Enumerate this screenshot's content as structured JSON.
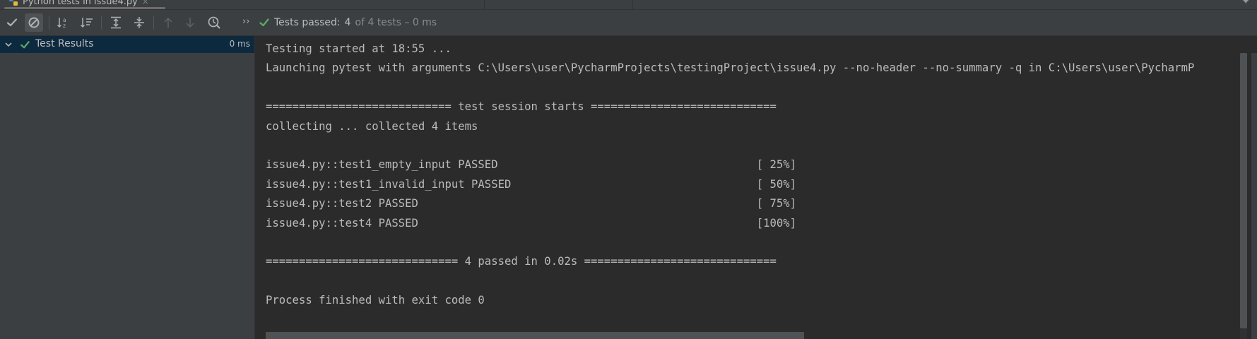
{
  "window": {
    "tab_label": "Python tests in issue4.py",
    "tab_close": "×"
  },
  "toolbar": {
    "buttons": [
      {
        "name": "show-passed",
        "icon": "checkmark-icon",
        "active": false
      },
      {
        "name": "show-ignored",
        "icon": "ignored-circle-icon",
        "active": true
      },
      {
        "name": "sort-alphabetically",
        "icon": "sort-az-icon",
        "active": false
      },
      {
        "name": "sort-by-duration",
        "icon": "sort-duration-icon",
        "active": false
      },
      {
        "name": "expand-all",
        "icon": "expand-all-icon",
        "active": false
      },
      {
        "name": "collapse-all",
        "icon": "collapse-all-icon",
        "active": false
      },
      {
        "name": "previous-failed",
        "icon": "arrow-up-icon",
        "active": false
      },
      {
        "name": "next-failed",
        "icon": "arrow-down-icon",
        "active": false
      },
      {
        "name": "test-history",
        "icon": "history-clock-icon",
        "active": false
      }
    ],
    "overflow_label": "››"
  },
  "status": {
    "prefix": "Tests passed:",
    "passed_count": "4",
    "suffix": "of 4 tests – 0 ms",
    "accent": "#59a869"
  },
  "tree": {
    "root_label": "Test Results",
    "root_duration": "0 ms",
    "selected_bg": "#0d293e"
  },
  "console": {
    "lines": [
      "Testing started at 18:55 ...",
      "Launching pytest with arguments C:\\Users\\user\\PycharmProjects\\testingProject\\issue4.py --no-header --no-summary -q in C:\\Users\\user\\PycharmP",
      "",
      "============================ test session starts ============================",
      "collecting ... collected 4 items",
      "",
      "issue4.py::test1_empty_input PASSED                                       [ 25%]",
      "issue4.py::test1_invalid_input PASSED                                     [ 50%]",
      "issue4.py::test2 PASSED                                                   [ 75%]",
      "issue4.py::test4 PASSED                                                   [100%]",
      "",
      "============================= 4 passed in 0.02s =============================",
      "",
      "Process finished with exit code 0"
    ]
  },
  "colors": {
    "panel_bg": "#3c3f41",
    "console_bg": "#2b2b2b",
    "text": "#bbbbbb",
    "icon": "#afb1b3",
    "disabled_icon": "#5d6062"
  }
}
